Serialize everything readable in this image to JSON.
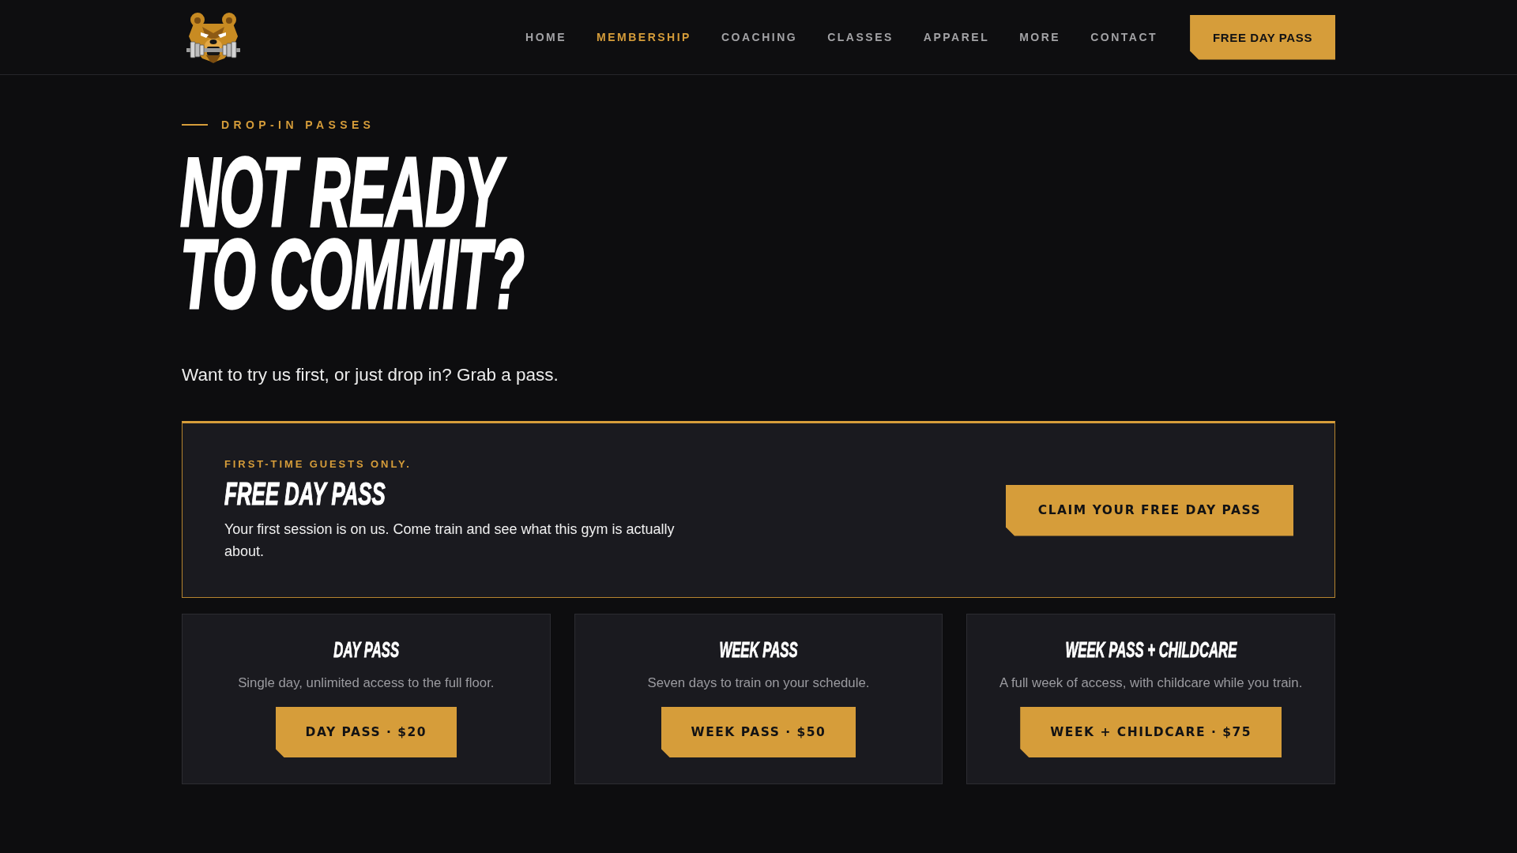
{
  "nav": {
    "links": [
      {
        "label": "HOME",
        "selected": false
      },
      {
        "label": "MEMBERSHIP",
        "selected": true
      },
      {
        "label": "COACHING",
        "selected": false
      },
      {
        "label": "CLASSES",
        "selected": false
      },
      {
        "label": "APPAREL",
        "selected": false
      },
      {
        "label": "MORE",
        "selected": false
      },
      {
        "label": "CONTACT",
        "selected": false
      }
    ],
    "cta": "FREE DAY PASS"
  },
  "hero": {
    "eyebrow": "DROP-IN PASSES",
    "heading_lines": [
      "NOT READY",
      "TO COMMIT?"
    ],
    "subtitle": "Want to try us first, or just drop in? Grab a pass."
  },
  "free_pass": {
    "eyebrow": "FIRST-TIME GUESTS ONLY.",
    "title": "FREE DAY PASS",
    "description": "Your first session is on us. Come train and see what this gym is actually about.",
    "button": "CLAIM YOUR FREE DAY PASS"
  },
  "passes": [
    {
      "title": "DAY PASS",
      "description": "Single day, unlimited access to the full floor.",
      "button": "DAY PASS · $20"
    },
    {
      "title": "WEEK PASS",
      "description": "Seven days to train on your schedule.",
      "button": "WEEK PASS · $50"
    },
    {
      "title": "WEEK PASS + CHILDCARE",
      "description": "A full week of access, with childcare while you train.",
      "button": "WEEK + CHILDCARE · $75"
    }
  ]
}
